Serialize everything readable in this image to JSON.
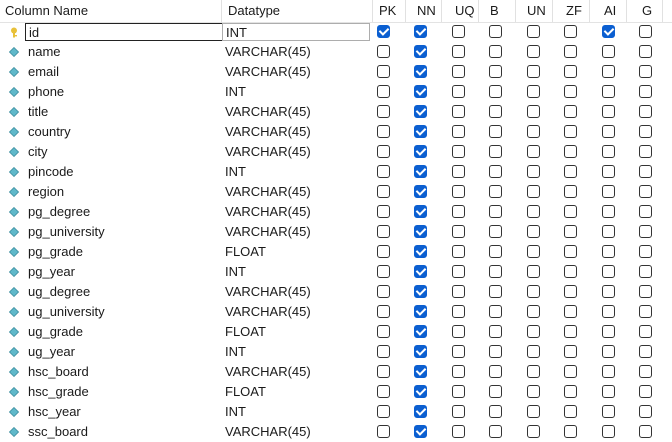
{
  "headers": {
    "column_name": "Column Name",
    "datatype": "Datatype",
    "flags": [
      "PK",
      "NN",
      "UQ",
      "B",
      "UN",
      "ZF",
      "AI",
      "G"
    ]
  },
  "colors": {
    "checked": "#0b5fd1",
    "key_icon": "#e8c13a",
    "column_icon": "#5fb8c9"
  },
  "rows": [
    {
      "name": "id",
      "type": "INT",
      "icon": "primary-key-icon",
      "flags": [
        true,
        true,
        false,
        false,
        false,
        false,
        true,
        false
      ],
      "selected": true
    },
    {
      "name": "name",
      "type": "VARCHAR(45)",
      "icon": "column-icon",
      "flags": [
        false,
        true,
        false,
        false,
        false,
        false,
        false,
        false
      ]
    },
    {
      "name": "email",
      "type": "VARCHAR(45)",
      "icon": "column-icon",
      "flags": [
        false,
        true,
        false,
        false,
        false,
        false,
        false,
        false
      ]
    },
    {
      "name": "phone",
      "type": "INT",
      "icon": "column-icon",
      "flags": [
        false,
        true,
        false,
        false,
        false,
        false,
        false,
        false
      ]
    },
    {
      "name": "title",
      "type": "VARCHAR(45)",
      "icon": "column-icon",
      "flags": [
        false,
        true,
        false,
        false,
        false,
        false,
        false,
        false
      ]
    },
    {
      "name": "country",
      "type": "VARCHAR(45)",
      "icon": "column-icon",
      "flags": [
        false,
        true,
        false,
        false,
        false,
        false,
        false,
        false
      ]
    },
    {
      "name": "city",
      "type": "VARCHAR(45)",
      "icon": "column-icon",
      "flags": [
        false,
        true,
        false,
        false,
        false,
        false,
        false,
        false
      ]
    },
    {
      "name": "pincode",
      "type": "INT",
      "icon": "column-icon",
      "flags": [
        false,
        true,
        false,
        false,
        false,
        false,
        false,
        false
      ]
    },
    {
      "name": "region",
      "type": "VARCHAR(45)",
      "icon": "column-icon",
      "flags": [
        false,
        true,
        false,
        false,
        false,
        false,
        false,
        false
      ]
    },
    {
      "name": "pg_degree",
      "type": "VARCHAR(45)",
      "icon": "column-icon",
      "flags": [
        false,
        true,
        false,
        false,
        false,
        false,
        false,
        false
      ]
    },
    {
      "name": "pg_university",
      "type": "VARCHAR(45)",
      "icon": "column-icon",
      "flags": [
        false,
        true,
        false,
        false,
        false,
        false,
        false,
        false
      ]
    },
    {
      "name": "pg_grade",
      "type": "FLOAT",
      "icon": "column-icon",
      "flags": [
        false,
        true,
        false,
        false,
        false,
        false,
        false,
        false
      ]
    },
    {
      "name": "pg_year",
      "type": "INT",
      "icon": "column-icon",
      "flags": [
        false,
        true,
        false,
        false,
        false,
        false,
        false,
        false
      ]
    },
    {
      "name": "ug_degree",
      "type": "VARCHAR(45)",
      "icon": "column-icon",
      "flags": [
        false,
        true,
        false,
        false,
        false,
        false,
        false,
        false
      ]
    },
    {
      "name": "ug_university",
      "type": "VARCHAR(45)",
      "icon": "column-icon",
      "flags": [
        false,
        true,
        false,
        false,
        false,
        false,
        false,
        false
      ]
    },
    {
      "name": "ug_grade",
      "type": "FLOAT",
      "icon": "column-icon",
      "flags": [
        false,
        true,
        false,
        false,
        false,
        false,
        false,
        false
      ]
    },
    {
      "name": "ug_year",
      "type": "INT",
      "icon": "column-icon",
      "flags": [
        false,
        true,
        false,
        false,
        false,
        false,
        false,
        false
      ]
    },
    {
      "name": "hsc_board",
      "type": "VARCHAR(45)",
      "icon": "column-icon",
      "flags": [
        false,
        true,
        false,
        false,
        false,
        false,
        false,
        false
      ]
    },
    {
      "name": "hsc_grade",
      "type": "FLOAT",
      "icon": "column-icon",
      "flags": [
        false,
        true,
        false,
        false,
        false,
        false,
        false,
        false
      ]
    },
    {
      "name": "hsc_year",
      "type": "INT",
      "icon": "column-icon",
      "flags": [
        false,
        true,
        false,
        false,
        false,
        false,
        false,
        false
      ]
    },
    {
      "name": "ssc_board",
      "type": "VARCHAR(45)",
      "icon": "column-icon",
      "flags": [
        false,
        true,
        false,
        false,
        false,
        false,
        false,
        false
      ]
    }
  ]
}
